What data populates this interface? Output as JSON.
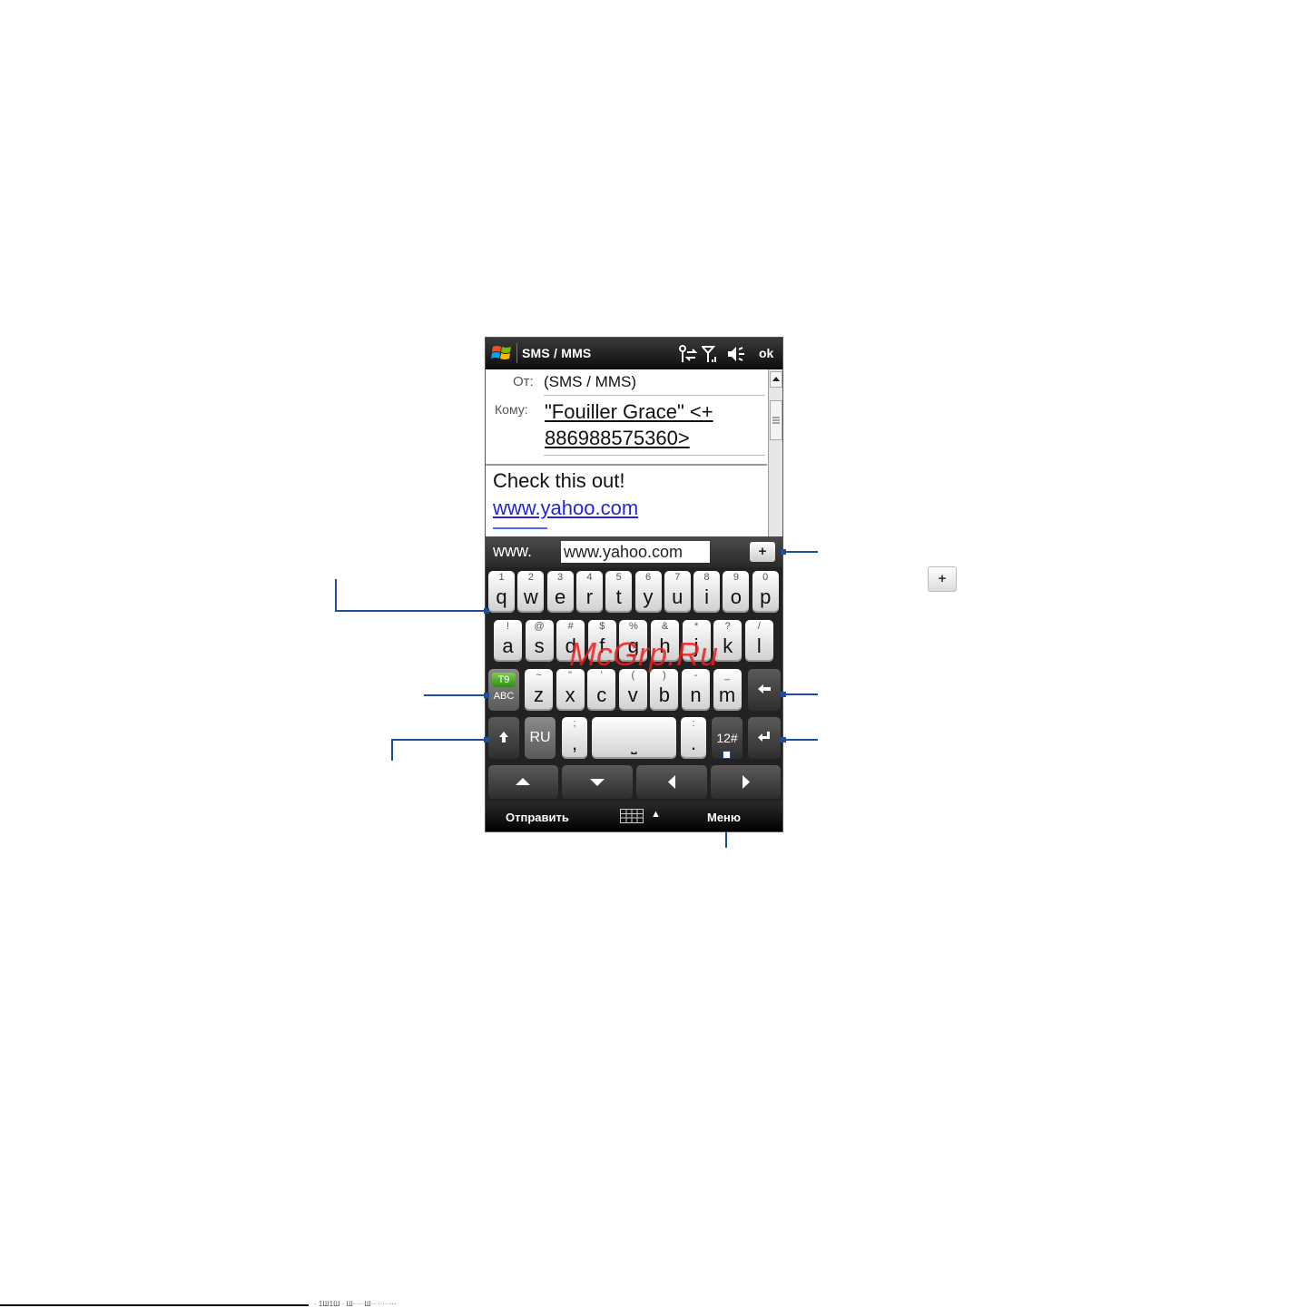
{
  "titlebar": {
    "app_title": "SMS / MMS",
    "ok_label": "ok"
  },
  "message": {
    "from_label": "От:",
    "from_value": "(SMS / MMS)",
    "to_label": "Кому:",
    "to_value": "\"Fouiller Grace\" <+ 886988575360>",
    "body_text": "Check this out!",
    "body_link": "www.yahoo.com"
  },
  "prediction": {
    "prefix": "www.",
    "word": "www.yahoo.com",
    "add_label": "+"
  },
  "keyboard": {
    "row1": [
      {
        "main": "q",
        "alt": "1"
      },
      {
        "main": "w",
        "alt": "2"
      },
      {
        "main": "e",
        "alt": "3"
      },
      {
        "main": "r",
        "alt": "4"
      },
      {
        "main": "t",
        "alt": "5"
      },
      {
        "main": "y",
        "alt": "6"
      },
      {
        "main": "u",
        "alt": "7"
      },
      {
        "main": "i",
        "alt": "8"
      },
      {
        "main": "o",
        "alt": "9"
      },
      {
        "main": "p",
        "alt": "0"
      }
    ],
    "row2": [
      {
        "main": "a",
        "alt": "!"
      },
      {
        "main": "s",
        "alt": "@"
      },
      {
        "main": "d",
        "alt": "#"
      },
      {
        "main": "f",
        "alt": "$"
      },
      {
        "main": "g",
        "alt": "%"
      },
      {
        "main": "h",
        "alt": "&"
      },
      {
        "main": "j",
        "alt": "*"
      },
      {
        "main": "k",
        "alt": "?"
      },
      {
        "main": "l",
        "alt": "/"
      }
    ],
    "row3": [
      {
        "main": "z",
        "alt": "~"
      },
      {
        "main": "x",
        "alt": "\""
      },
      {
        "main": "c",
        "alt": "'"
      },
      {
        "main": "v",
        "alt": "("
      },
      {
        "main": "b",
        "alt": ")"
      },
      {
        "main": "n",
        "alt": "-"
      },
      {
        "main": "m",
        "alt": "_"
      }
    ],
    "t9_label": "T9",
    "abc_label": "ABC",
    "ru_label": "RU",
    "comma": ",",
    "comma_alt": ";",
    "period": ".",
    "period_alt": ":",
    "space_label": "⎵",
    "num_label": "12#"
  },
  "softbar": {
    "left_label": "Отправить",
    "right_label": "Меню"
  },
  "callouts": {
    "plus_icon_label": "+"
  },
  "watermark": "McGrp.Ru",
  "footer": "· 1Ш1Ш · Ш· ·· Ш·· · ·· ···"
}
